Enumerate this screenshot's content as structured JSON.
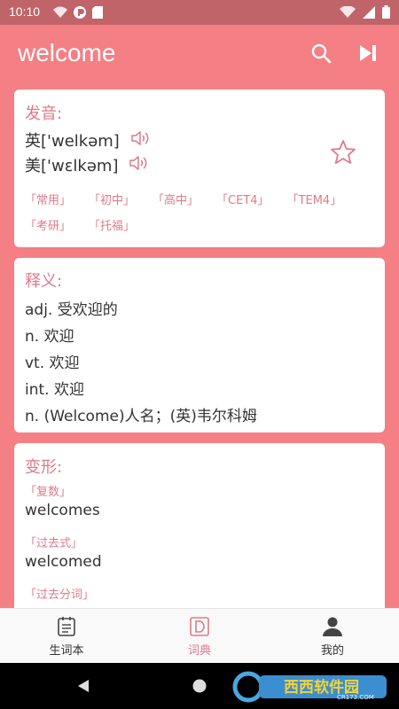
{
  "status_bar": {
    "time": "10:10"
  },
  "app_bar": {
    "title": "welcome"
  },
  "pronunciation": {
    "title": "发音:",
    "uk": "英['welkəm]",
    "us": "美['wɛlkəm]",
    "tags": [
      "「常用」",
      "「初中」",
      "「高中」",
      "「CET4」",
      "「TEM4」",
      "「考研」",
      "「托福」"
    ]
  },
  "definitions": {
    "title": "释义:",
    "lines": [
      "adj. 受欢迎的",
      "n. 欢迎",
      "vt. 欢迎",
      "int. 欢迎",
      "n. (Welcome)人名；(英)韦尔科姆"
    ]
  },
  "forms": {
    "title": "变形:",
    "items": [
      {
        "label": "「复数」",
        "value": "welcomes"
      },
      {
        "label": "「过去式」",
        "value": "welcomed"
      },
      {
        "label": "「过去分词」",
        "value": ""
      }
    ]
  },
  "bottom_nav": {
    "items": [
      {
        "label": "生词本",
        "icon": "notebook-icon"
      },
      {
        "label": "词典",
        "icon": "dictionary-icon"
      },
      {
        "label": "我的",
        "icon": "person-icon"
      }
    ],
    "active_index": 1
  },
  "watermark": {
    "text": "西西软件园",
    "sub": "CR173.COM"
  },
  "colors": {
    "accent": "#f47f84",
    "status_bar": "#c1646a",
    "tag": "#e07a88"
  }
}
